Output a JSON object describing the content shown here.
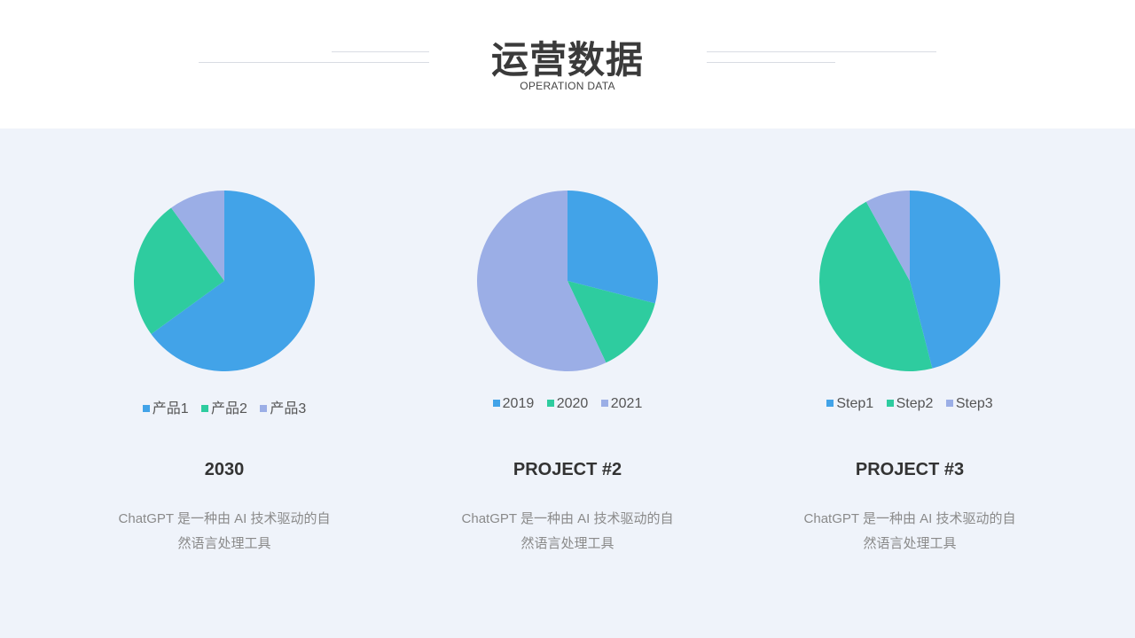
{
  "header": {
    "title": "运营数据",
    "subtitle": "OPERATION DATA"
  },
  "colors": {
    "series1": "#42a3e8",
    "series2": "#2ecc9f",
    "series3": "#9baee6",
    "background": "#eff3fa"
  },
  "chart_data": [
    {
      "type": "pie",
      "categories": [
        "产品1",
        "产品2",
        "产品3"
      ],
      "values": [
        65,
        25,
        10
      ],
      "legend_position": "bottom"
    },
    {
      "type": "pie",
      "categories": [
        "2019",
        "2020",
        "2021"
      ],
      "values": [
        29,
        14,
        57
      ],
      "legend_position": "bottom"
    },
    {
      "type": "pie",
      "categories": [
        "Step1",
        "Step2",
        "Step3"
      ],
      "values": [
        46,
        46,
        8
      ],
      "legend_position": "bottom"
    }
  ],
  "projects": [
    {
      "title": "2030",
      "desc_line1": "ChatGPT 是一种由 AI 技术驱动的自",
      "desc_line2": "然语言处理工具"
    },
    {
      "title": "PROJECT #2",
      "desc_line1": "ChatGPT 是一种由 AI 技术驱动的自",
      "desc_line2": "然语言处理工具"
    },
    {
      "title": "PROJECT #3",
      "desc_line1": "ChatGPT 是一种由 AI 技术驱动的自",
      "desc_line2": "然语言处理工具"
    }
  ]
}
